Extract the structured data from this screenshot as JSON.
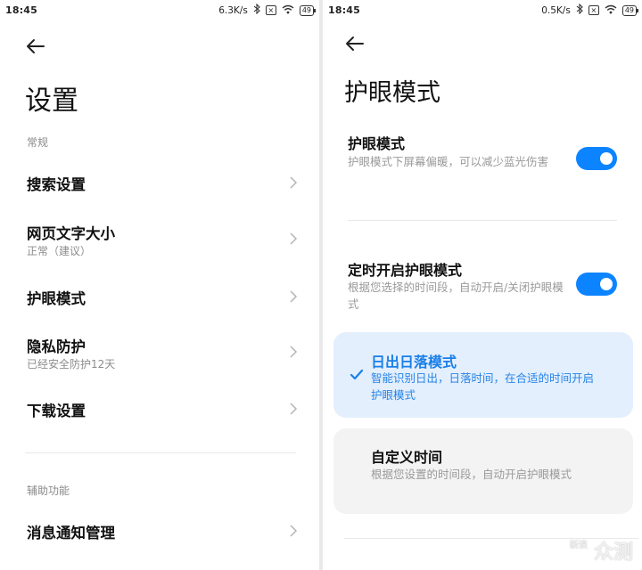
{
  "left": {
    "status": {
      "time": "18:45",
      "speed": "6.3K/s",
      "battery": "49"
    },
    "title": "设置",
    "section_general": "常规",
    "items": [
      {
        "title": "搜索设置",
        "subtitle": ""
      },
      {
        "title": "网页文字大小",
        "subtitle": "正常（建议）"
      },
      {
        "title": "护眼模式",
        "subtitle": ""
      },
      {
        "title": "隐私防护",
        "subtitle": "已经安全防护12天"
      },
      {
        "title": "下载设置",
        "subtitle": ""
      }
    ],
    "section_accessibility": "辅助功能",
    "items2": [
      {
        "title": "消息通知管理"
      }
    ]
  },
  "right": {
    "status": {
      "time": "18:45",
      "speed": "0.5K/s",
      "battery": "49"
    },
    "title": "护眼模式",
    "eye_mode": {
      "title": "护眼模式",
      "desc": "护眼模式下屏幕偏暖，可以减少蓝光伤害",
      "on": true
    },
    "scheduled": {
      "title": "定时开启护眼模式",
      "desc": "根据您选择的时间段，自动开启/关闭护眼模式",
      "on": true
    },
    "options": [
      {
        "title": "日出日落模式",
        "desc": "智能识别日出，日落时间，在合适的时间开启护眼模式",
        "selected": true
      },
      {
        "title": "自定义时间",
        "desc": "根据您设置的时间段，自动开启护眼模式",
        "selected": false
      }
    ]
  },
  "watermark": {
    "text": "众测",
    "badge": "新浪"
  },
  "colors": {
    "accent": "#0d84ff",
    "selected_bg": "#e3effd",
    "selected_text": "#1a7fe8"
  },
  "icons": [
    "back-arrow-icon",
    "chevron-right-icon",
    "check-icon",
    "bluetooth-icon",
    "wifi-icon",
    "battery-icon"
  ]
}
